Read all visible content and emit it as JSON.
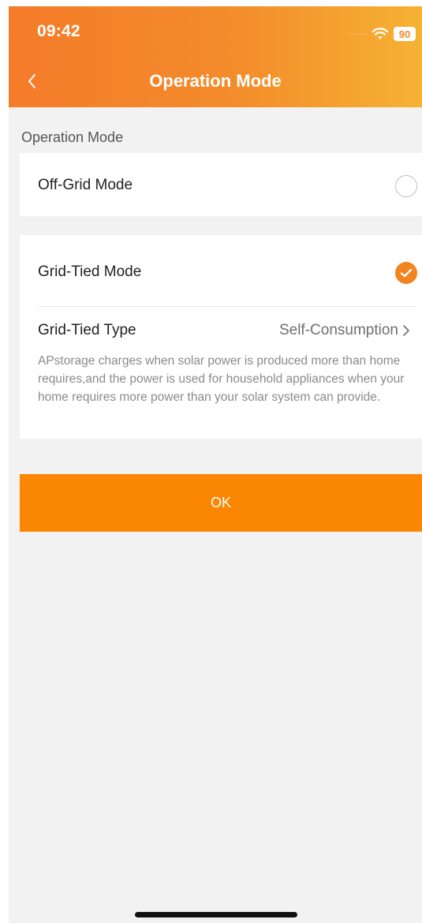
{
  "status_bar": {
    "time": "09:42",
    "signal_dots": "·····",
    "battery": "90"
  },
  "nav": {
    "title": "Operation Mode",
    "back_icon": "chevron-left-icon"
  },
  "section": {
    "label": "Operation Mode"
  },
  "modes": {
    "off_grid": {
      "label": "Off-Grid Mode",
      "selected": false
    },
    "grid_tied": {
      "label": "Grid-Tied Mode",
      "selected": true,
      "type_label": "Grid-Tied Type",
      "type_value": "Self-Consumption",
      "description": "APstorage charges when solar power is produced more than home requires,and the power is used for household appliances when your home requires more power than your solar system can provide."
    }
  },
  "actions": {
    "ok_label": "OK"
  },
  "colors": {
    "accent": "#fb8603",
    "header_gradient_start": "#f47b2a",
    "header_gradient_end": "#f6b233",
    "background": "#f2f2f2",
    "check": "#f28421"
  }
}
